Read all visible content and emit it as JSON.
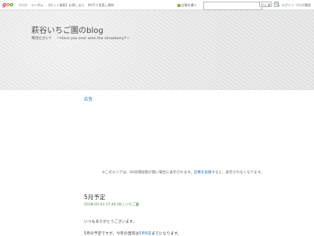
{
  "topbar": {
    "logo": {
      "g": "g",
      "o1": "o",
      "o2": "o"
    },
    "nav": [
      "ブログ",
      "ランダム",
      "【ネット検索】お探しなら",
      "Wi-Fiで見直し節約"
    ],
    "follow_label": "記事を書く",
    "search_placeholder": "",
    "search_scope": "ウェブ",
    "search_button": "🔍",
    "right_links": "ログイン  ブログ開設"
  },
  "header": {
    "title": "萩谷いちご園のblog",
    "subtitle": "苺見たかい？　～Have you ever seen the strawberry?～"
  },
  "ad": {
    "label": "広告",
    "notice_before": "※このエリアは、60日間投稿が無い場合に表示されます。",
    "notice_link": "記事を投稿",
    "notice_after": "すると、表示されなくなります。"
  },
  "post": {
    "title": "5月予定",
    "meta": "2018-05-03 17:40:28 | いちご園",
    "line1": "いつもありがとうございます。",
    "line2_before": "5月の予定ですが、今年の直売は",
    "line2_highlight": "5月6日",
    "line2_after": "までになります。"
  },
  "colors": {
    "accent": "#1f6fb2",
    "logo_g": "#e62e8b",
    "logo_o1": "#f08a00",
    "logo_o2": "#3aa335"
  }
}
